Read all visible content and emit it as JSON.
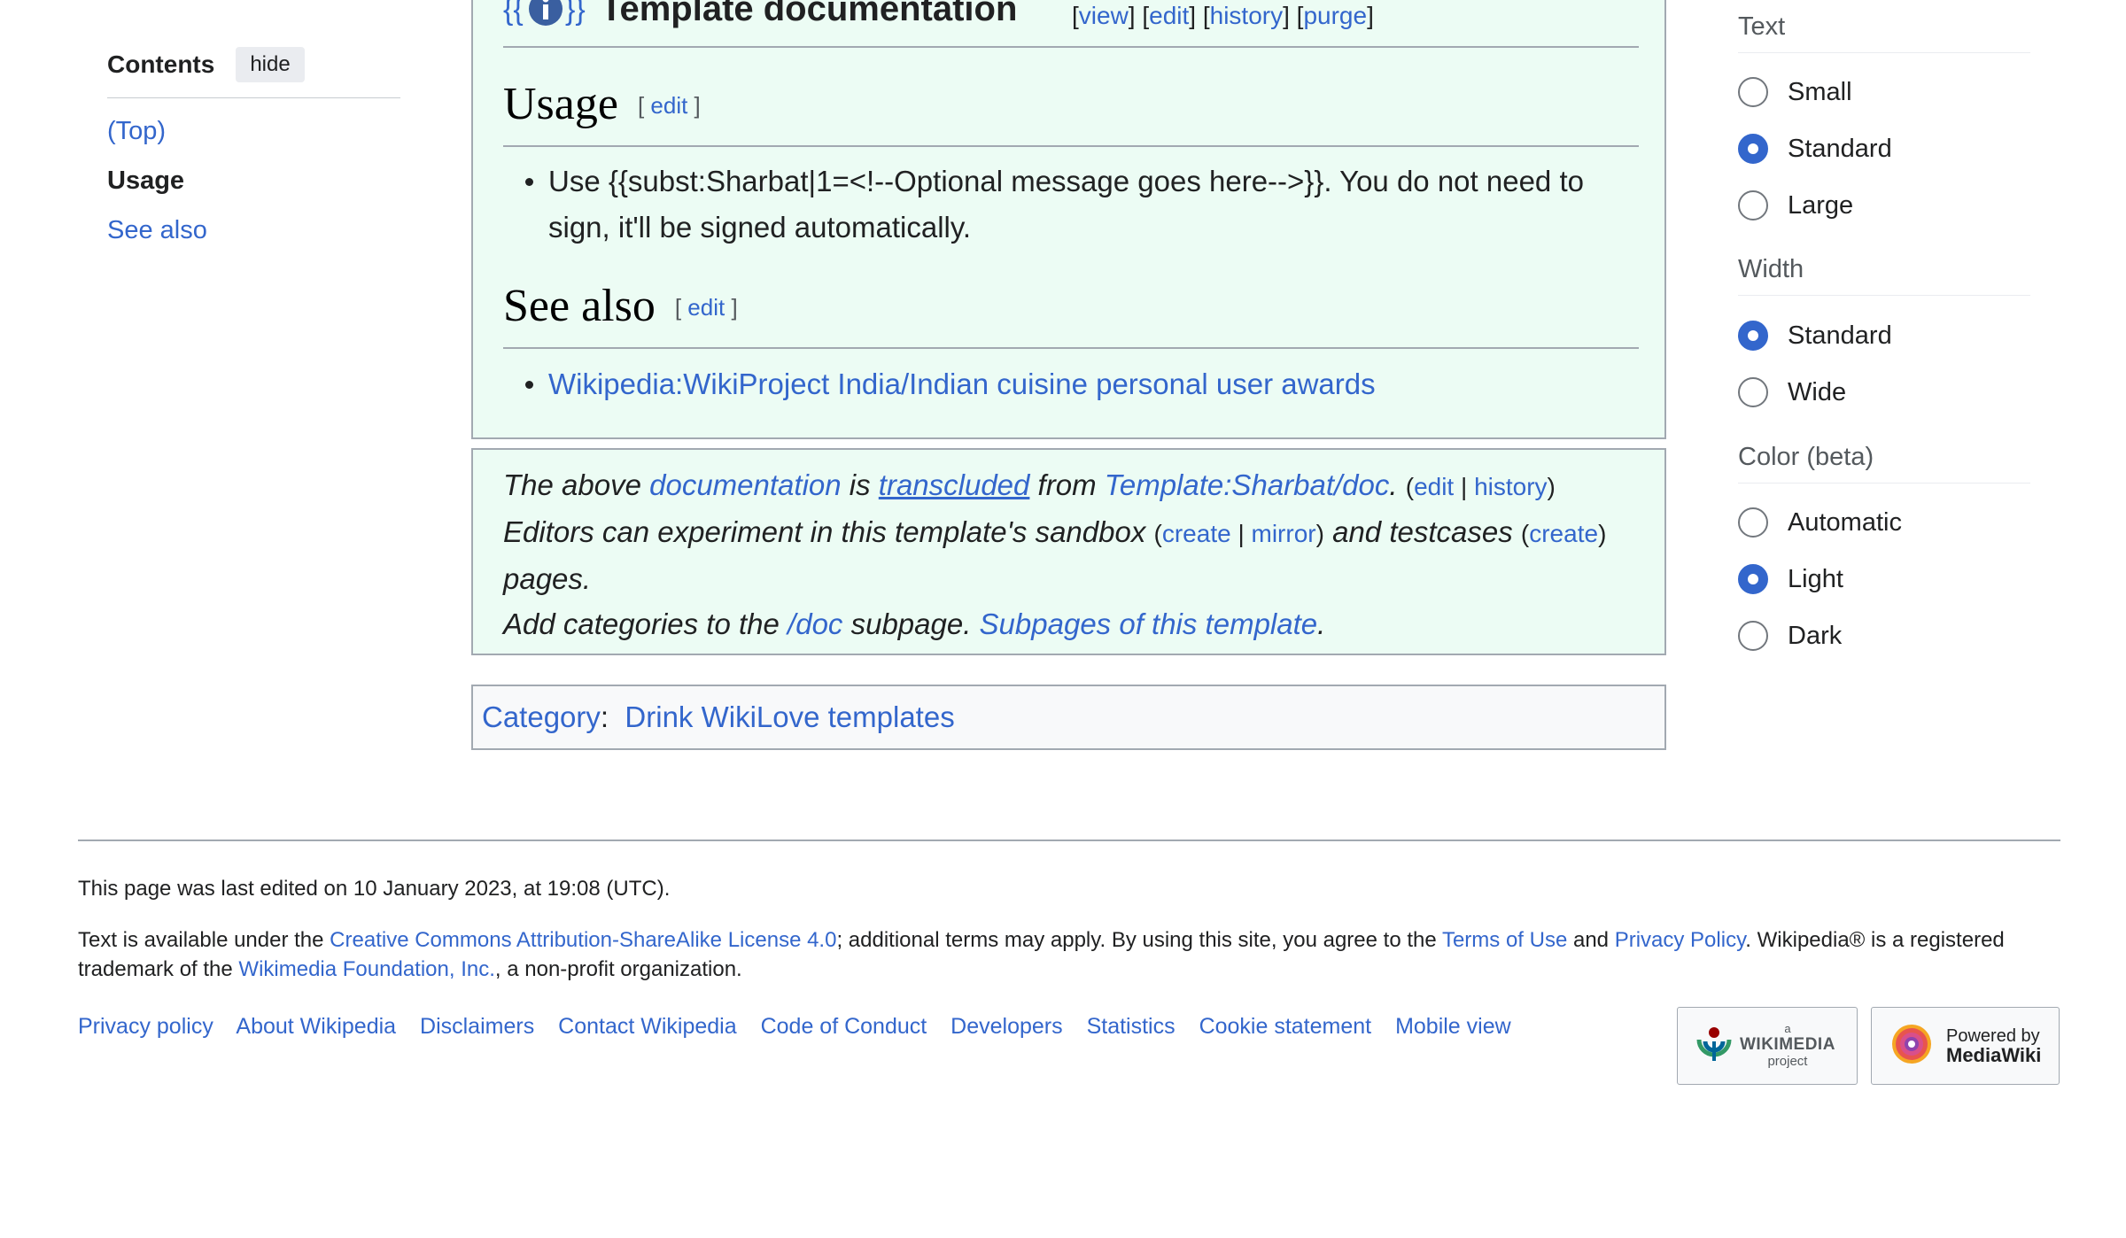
{
  "toc": {
    "title": "Contents",
    "hide": "hide",
    "items": [
      {
        "label": "(Top)"
      },
      {
        "label": "Usage"
      },
      {
        "label": "See also"
      }
    ]
  },
  "doc": {
    "title": "Template documentation",
    "links": {
      "view": "view",
      "edit": "edit",
      "history": "history",
      "purge": "purge"
    },
    "usage": {
      "heading": "Usage",
      "edit": "edit",
      "text": "Use {{subst:Sharbat|1=<!--Optional message goes here-->}}. You do not need to sign, it'll be signed automatically."
    },
    "see_also": {
      "heading": "See also",
      "edit": "edit",
      "link": "Wikipedia:WikiProject India/Indian cuisine personal user awards"
    }
  },
  "notice": {
    "t1": "The above ",
    "documentation": "documentation",
    "t2": " is ",
    "transcluded": "transcluded",
    "t3": " from ",
    "doc_page": "Template:Sharbat/doc",
    "t4": ". ",
    "edit": "edit",
    "history": "history",
    "t5": "Editors can experiment in this template's sandbox ",
    "create": "create",
    "mirror": "mirror",
    "t6": " and testcases ",
    "create2": "create",
    "t7": " pages.",
    "t8": "Add categories to the ",
    "doc_sub": "/doc",
    "t9": " subpage. ",
    "subpages": "Subpages of this template",
    "t10": "."
  },
  "category": {
    "label": "Category",
    "item": "Drink WikiLove templates"
  },
  "appearance": {
    "text": {
      "heading": "Text",
      "options": [
        "Small",
        "Standard",
        "Large"
      ],
      "selected": "Standard"
    },
    "width": {
      "heading": "Width",
      "options": [
        "Standard",
        "Wide"
      ],
      "selected": "Standard"
    },
    "color": {
      "heading": "Color (beta)",
      "options": [
        "Automatic",
        "Light",
        "Dark"
      ],
      "selected": "Light"
    }
  },
  "footer": {
    "last_edited": "This page was last edited on 10 January 2023, at 19:08 (UTC).",
    "license_1": "Text is available under the ",
    "license_link": "Creative Commons Attribution-ShareAlike License 4.0",
    "license_2": "; additional terms may apply. By using this site, you agree to the ",
    "terms": "Terms of Use",
    "and": " and ",
    "privacy": "Privacy Policy",
    "license_3": ". Wikipedia® is a registered trademark of the ",
    "foundation": "Wikimedia Foundation, Inc.",
    "license_4": ", a non-profit organization.",
    "links": [
      "Privacy policy",
      "About Wikipedia",
      "Disclaimers",
      "Contact Wikipedia",
      "Code of Conduct",
      "Developers",
      "Statistics",
      "Cookie statement",
      "Mobile view"
    ],
    "wikimedia_badge": {
      "small": "a",
      "main": "WIKIMEDIA",
      "sub": "project"
    },
    "mediawiki_badge": {
      "line1": "Powered by",
      "line2": "MediaWiki"
    }
  },
  "colors": {
    "link": "#3366cc",
    "doc_bg": "#ecfcf4",
    "border": "#a2a9b1",
    "radio_on": "#3366cc"
  }
}
